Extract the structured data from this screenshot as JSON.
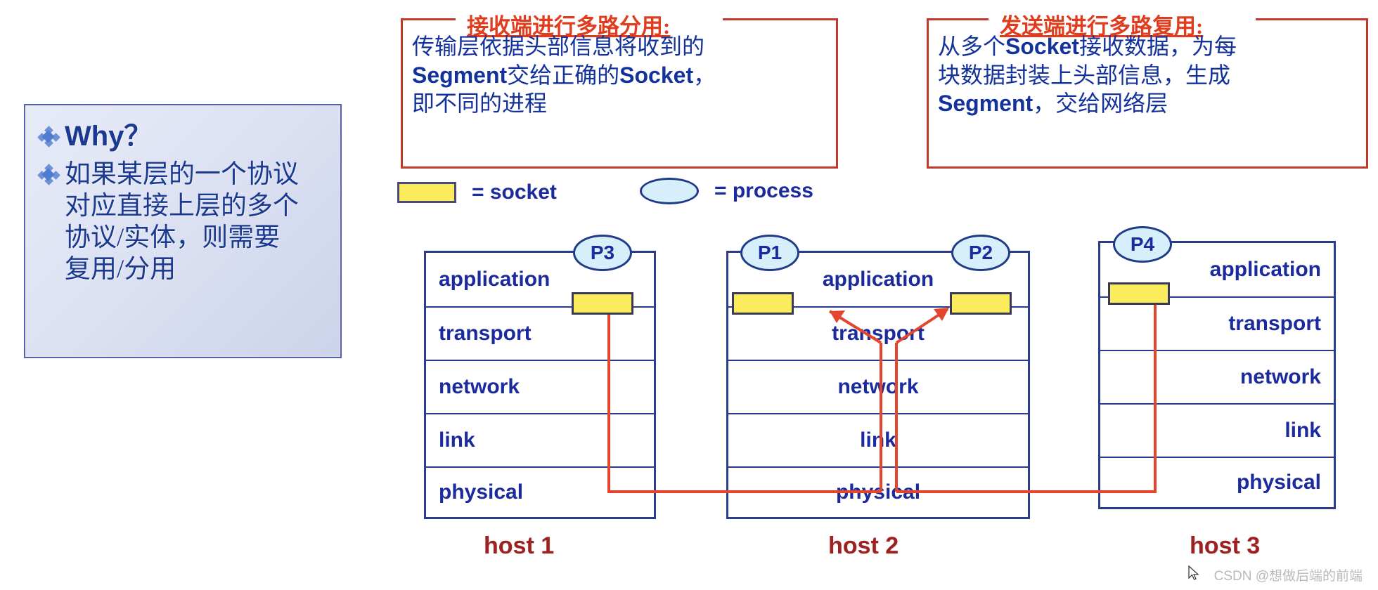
{
  "why_panel": {
    "bullet_icon": "diamond-bullet-icon",
    "title": "Why？",
    "body": "如果某层的一个协议对应直接上层的多个协议/实体，则需要复用/分用"
  },
  "callouts": [
    {
      "id": "demux",
      "caption": "接收端进行多路分用:",
      "lines": [
        "传输层依据头部信息将收到的",
        "Segment交给正确的Socket，",
        "即不同的进程"
      ],
      "border_color": "#c0392b",
      "caption_color": "#e03c1e",
      "text_color": "#14329b"
    },
    {
      "id": "mux",
      "caption": "发送端进行多路复用:",
      "lines": [
        "从多个Socket接收数据，为每",
        "块数据封装上头部信息，生成",
        "Segment，交给网络层"
      ],
      "border_color": "#c0392b",
      "caption_color": "#e03c1e",
      "text_color": "#14329b"
    }
  ],
  "legend": {
    "socket": {
      "icon": "socket-rectangle-icon",
      "label": "= socket",
      "color": "#fbec5d"
    },
    "process": {
      "icon": "process-ellipse-icon",
      "label": "= process",
      "color": "#d7eefb"
    }
  },
  "hosts": [
    {
      "name": "host 1",
      "label": "host 1",
      "align": "left",
      "layers": [
        "application",
        "transport",
        "network",
        "link",
        "physical"
      ],
      "processes": [
        {
          "name": "P3",
          "side": "right"
        }
      ],
      "sockets": 1
    },
    {
      "name": "host 2",
      "label": "host 2",
      "align": "center",
      "layers": [
        "application",
        "transport",
        "network",
        "link",
        "physical"
      ],
      "processes": [
        {
          "name": "P1",
          "side": "left"
        },
        {
          "name": "P2",
          "side": "right"
        }
      ],
      "sockets": 2
    },
    {
      "name": "host 3",
      "label": "host 3",
      "align": "right",
      "layers": [
        "application",
        "transport",
        "network",
        "link",
        "physical"
      ],
      "processes": [
        {
          "name": "P4",
          "side": "left"
        }
      ],
      "sockets": 1
    }
  ],
  "colors": {
    "stack_border": "#2b3c8f",
    "layer_text": "#1b2a9c",
    "wire": "#e4452c",
    "host_label": "#9e2020",
    "panel_text": "#1b3a8f"
  },
  "watermark": "CSDN @想做后端的前端"
}
